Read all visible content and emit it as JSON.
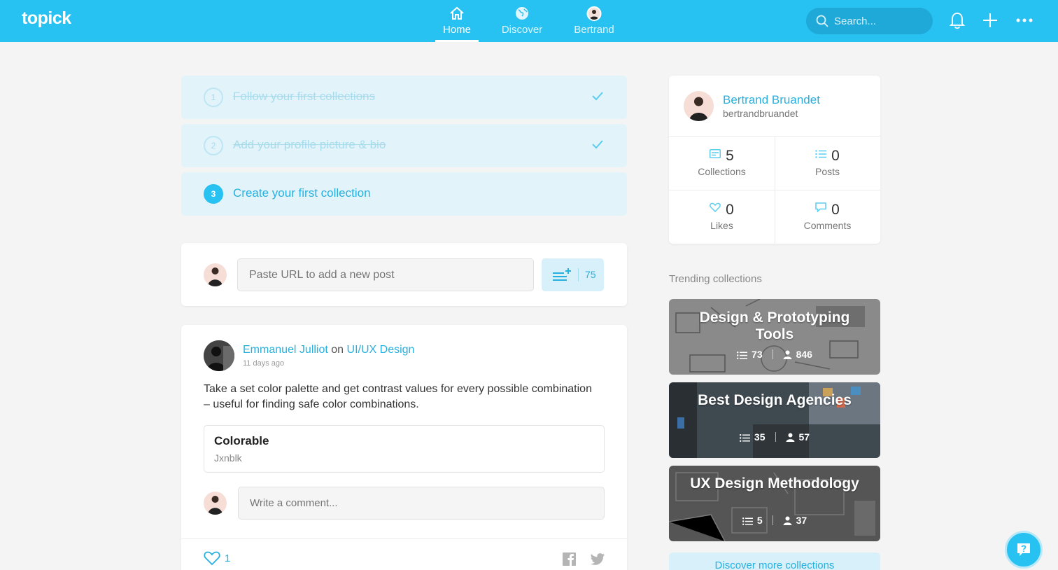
{
  "app": {
    "logo": "topick"
  },
  "nav": {
    "home": "Home",
    "discover": "Discover",
    "me": "Bertrand"
  },
  "search": {
    "placeholder": "Search..."
  },
  "onboarding": {
    "steps": [
      {
        "num": "1",
        "label": "Follow your first collections",
        "done": true
      },
      {
        "num": "2",
        "label": "Add your profile picture & bio",
        "done": true
      },
      {
        "num": "3",
        "label": "Create your first collection",
        "done": false
      }
    ]
  },
  "new_post": {
    "placeholder": "Paste URL to add a new post",
    "count": "75"
  },
  "post": {
    "author": "Emmanuel Julliot",
    "on": "on",
    "collection": "UI/UX Design",
    "time": "11 days ago",
    "body": "Take a set color palette and get contrast values for every possible combination – useful for finding safe color combinations.",
    "link_title": "Colorable",
    "link_sub": "Jxnblk",
    "comment_placeholder": "Write a comment...",
    "likes": "1"
  },
  "profile": {
    "name": "Bertrand Bruandet",
    "handle": "bertrandbruandet",
    "stats": {
      "collections": {
        "value": "5",
        "label": "Collections"
      },
      "posts": {
        "value": "0",
        "label": "Posts"
      },
      "likes": {
        "value": "0",
        "label": "Likes"
      },
      "comments": {
        "value": "0",
        "label": "Comments"
      }
    }
  },
  "trending": {
    "title": "Trending collections",
    "items": [
      {
        "name": "Design & Prototyping Tools",
        "posts": "73",
        "followers": "846"
      },
      {
        "name": "Best Design Agencies",
        "posts": "35",
        "followers": "57"
      },
      {
        "name": "UX Design Methodology",
        "posts": "5",
        "followers": "37"
      }
    ],
    "more": "Discover more collections"
  },
  "colors": {
    "accent": "#27c1f2",
    "accent_text": "#27b0de",
    "step_bg": "#e3f3fa"
  }
}
